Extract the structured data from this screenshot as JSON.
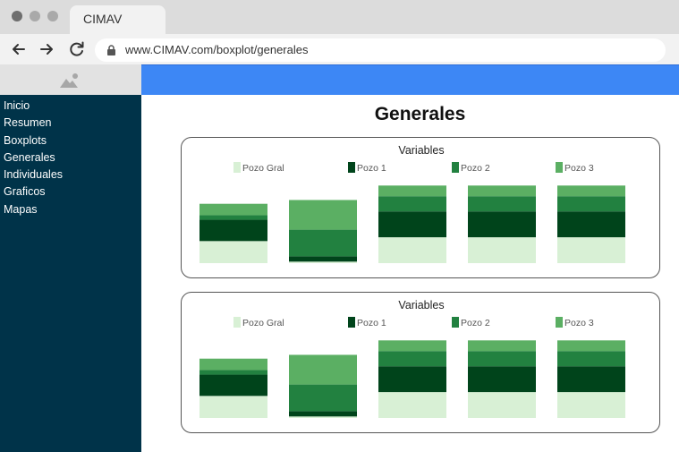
{
  "browser": {
    "tab_title": "CIMAV",
    "url": "www.CIMAV.com/boxplot/generales"
  },
  "sidebar": {
    "items": [
      {
        "label": "Inicio"
      },
      {
        "label": "Resumen"
      },
      {
        "label": "Boxplots"
      },
      {
        "label": "Generales"
      },
      {
        "label": "Individuales"
      },
      {
        "label": "Graficos"
      },
      {
        "label": "Mapas"
      }
    ]
  },
  "main": {
    "title": "Generales"
  },
  "colors": {
    "accent_header": "#3d87f5",
    "sidebar_bg": "#003349",
    "pozo_gral": "#d8f0d5",
    "pozo_1": "#00441b",
    "pozo_2": "#228140",
    "pozo_3": "#5baf63"
  },
  "chart_data": [
    {
      "type": "bar",
      "stacked": true,
      "title": "Variables",
      "legend": [
        "Pozo Gral",
        "Pozo 1",
        "Pozo 2",
        "Pozo 3"
      ],
      "legend_position": "top",
      "grid": false,
      "ylim": [
        0,
        100
      ],
      "categories": [
        "",
        "",
        "",
        "",
        ""
      ],
      "series": [
        {
          "name": "Pozo Gral",
          "values": [
            29,
            2,
            34,
            34,
            34
          ]
        },
        {
          "name": "Pozo 1",
          "values": [
            28,
            7,
            34,
            34,
            34
          ]
        },
        {
          "name": "Pozo 2",
          "values": [
            6,
            35,
            20,
            20,
            20
          ]
        },
        {
          "name": "Pozo 3",
          "values": [
            15,
            39,
            14,
            14,
            14
          ]
        }
      ]
    },
    {
      "type": "bar",
      "stacked": true,
      "title": "Variables",
      "legend": [
        "Pozo Gral",
        "Pozo 1",
        "Pozo 2",
        "Pozo 3"
      ],
      "legend_position": "top",
      "grid": false,
      "ylim": [
        0,
        100
      ],
      "categories": [
        "",
        "",
        "",
        "",
        ""
      ],
      "series": [
        {
          "name": "Pozo Gral",
          "values": [
            29,
            2,
            34,
            34,
            34
          ]
        },
        {
          "name": "Pozo 1",
          "values": [
            28,
            7,
            34,
            34,
            34
          ]
        },
        {
          "name": "Pozo 2",
          "values": [
            6,
            35,
            20,
            20,
            20
          ]
        },
        {
          "name": "Pozo 3",
          "values": [
            15,
            39,
            14,
            14,
            14
          ]
        }
      ]
    }
  ]
}
